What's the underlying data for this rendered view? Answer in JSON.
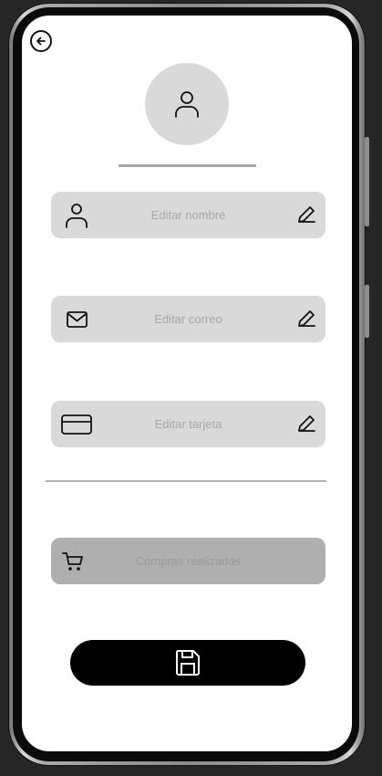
{
  "profile": {
    "back_icon": "arrow-left-circle-icon",
    "avatar_icon": "user-icon"
  },
  "fields": [
    {
      "icon": "user-icon",
      "placeholder": "Editar nombre",
      "action_icon": "pencil-icon"
    },
    {
      "icon": "mail-icon",
      "placeholder": "Editar correo",
      "action_icon": "pencil-icon"
    },
    {
      "icon": "credit-card-icon",
      "placeholder": "Editar tarjeta",
      "action_icon": "pencil-icon"
    }
  ],
  "purchases": {
    "icon": "shopping-cart-icon",
    "label": "Compras realizadas"
  },
  "save_button": {
    "icon": "save-icon"
  },
  "colors": {
    "field_bg": "#d9d9d9",
    "purchases_bg": "#afafaf",
    "save_bg": "#000000",
    "placeholder_text": "#a7a7a7"
  }
}
